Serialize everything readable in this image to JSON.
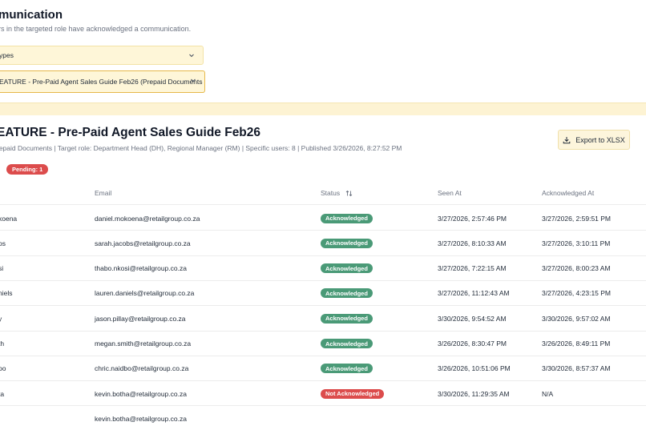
{
  "header": {
    "title": "munication",
    "subtitle": "rs in the targeted role have acknowledged a communication."
  },
  "filters": {
    "type_select_value": "ypes",
    "communication_select_value": "EATURE - Pre-Paid Agent Sales Guide Feb26 (Prepaid Documents |..."
  },
  "communication": {
    "title": "EATURE - Pre-Paid Agent Sales Guide Feb26",
    "meta": "repaid Documents | Target role: Department Head (DH), Regional Manager (RM) | Specific users: 8 | Published 3/26/2026, 8:27:52 PM",
    "pending_badge": "Pending: 1"
  },
  "toolbar": {
    "export_label": "Export to XLSX"
  },
  "table": {
    "columns": {
      "email": "Email",
      "status": "Status",
      "seen_at": "Seen At",
      "acknowledged_at": "Acknowledged At"
    },
    "rows": [
      {
        "name": "koena",
        "email": "daniel.mokoena@retailgroup.co.za",
        "status": "Acknowledged",
        "acknowledged": true,
        "seen_at": "3/27/2026, 2:57:46 PM",
        "ack_at": "3/27/2026, 2:59:51 PM"
      },
      {
        "name": "os",
        "email": "sarah.jacobs@retailgroup.co.za",
        "status": "Acknowledged",
        "acknowledged": true,
        "seen_at": "3/27/2026, 8:10:33 AM",
        "ack_at": "3/27/2026, 3:10:11 PM"
      },
      {
        "name": "si",
        "email": "thabo.nkosi@retailgroup.co.za",
        "status": "Acknowledged",
        "acknowledged": true,
        "seen_at": "3/27/2026, 7:22:15 AM",
        "ack_at": "3/27/2026, 8:00:23 AM"
      },
      {
        "name": "niels",
        "email": "lauren.daniels@retailgroup.co.za",
        "status": "Acknowledged",
        "acknowledged": true,
        "seen_at": "3/27/2026, 11:12:43 AM",
        "ack_at": "3/27/2026, 4:23:15 PM"
      },
      {
        "name": "y",
        "email": "jason.pillay@retailgroup.co.za",
        "status": "Acknowledged",
        "acknowledged": true,
        "seen_at": "3/30/2026, 9:54:52 AM",
        "ack_at": "3/30/2026, 9:57:02 AM"
      },
      {
        "name": "th",
        "email": "megan.smith@retailgroup.co.za",
        "status": "Acknowledged",
        "acknowledged": true,
        "seen_at": "3/26/2026, 8:30:47 PM",
        "ack_at": "3/26/2026, 8:49:11 PM"
      },
      {
        "name": "oo",
        "email": "chric.naidbo@retailgroup.co.za",
        "status": "Acknowledged",
        "acknowledged": true,
        "seen_at": "3/26/2026, 10:51:06 PM",
        "ack_at": "3/30/2026, 8:57:37 AM"
      },
      {
        "name": "ta",
        "email": "kevin.botha@retailgroup.co.za",
        "status": "Not Acknowledged",
        "acknowledged": false,
        "seen_at": "3/30/2026, 11:29:35 AM",
        "ack_at": "N/A"
      },
      {
        "name": "",
        "email": "kevin.botha@retailgroup.co.za",
        "status": "",
        "acknowledged": null,
        "seen_at": "",
        "ack_at": ""
      }
    ]
  },
  "colors": {
    "acknowledged": "#4a9a77",
    "not_acknowledged": "#dc4c4c",
    "select_bg": "#fef6d8",
    "focus_border": "#e6b84a"
  }
}
